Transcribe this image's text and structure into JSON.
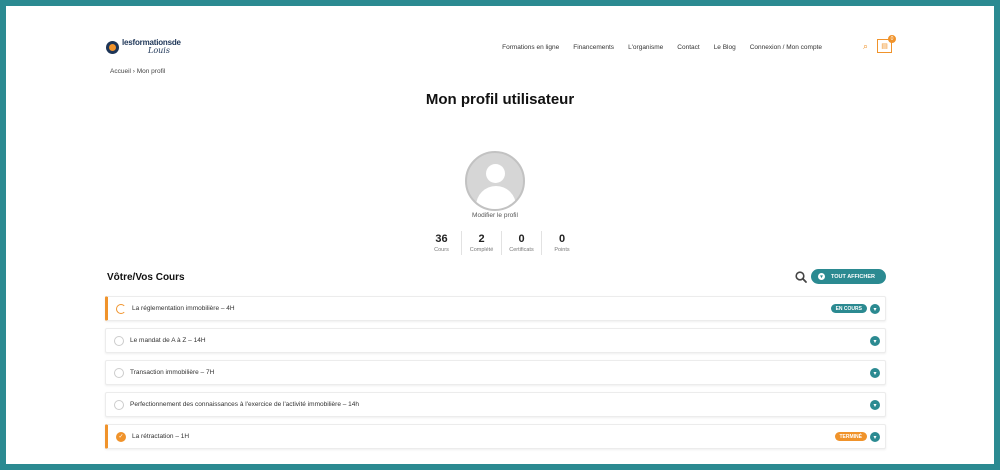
{
  "brand": {
    "name_top": "lesformationsde",
    "name_bottom": "Louis"
  },
  "nav": {
    "items": [
      {
        "label": "Formations en ligne"
      },
      {
        "label": "Financements"
      },
      {
        "label": "L'organisme"
      },
      {
        "label": "Contact"
      },
      {
        "label": "Le Blog"
      },
      {
        "label": "Connexion / Mon compte"
      }
    ],
    "cart_count": "0"
  },
  "breadcrumb": "Accueil › Mon profil",
  "page": {
    "title": "Mon profil utilisateur",
    "edit_profile": "Modifier le profil"
  },
  "stats": [
    {
      "value": "36",
      "label": "Cours"
    },
    {
      "value": "2",
      "label": "Complété"
    },
    {
      "value": "0",
      "label": "Certificats"
    },
    {
      "value": "0",
      "label": "Points"
    }
  ],
  "courses": {
    "title": "Vôtre/Vos Cours",
    "filter_label": "TOUT AFFICHER",
    "items": [
      {
        "name": "La réglementation immobilière – 4H",
        "status": "progress",
        "badge": "EN COURS",
        "badge_color": "#2b8a91"
      },
      {
        "name": "Le mandat de A à Z – 14H",
        "status": "none",
        "badge": "",
        "badge_color": ""
      },
      {
        "name": "Transaction immobilière – 7H",
        "status": "none",
        "badge": "",
        "badge_color": ""
      },
      {
        "name": "Perfectionnement des connaissances à l'exercice de l'activité immobilière – 14h",
        "status": "none",
        "badge": "",
        "badge_color": ""
      },
      {
        "name": "La rétractation – 1H",
        "status": "done",
        "badge": "TERMINÉ",
        "badge_color": "#f0932b"
      }
    ]
  },
  "colors": {
    "accent": "#2b8a91",
    "brand_orange": "#f0932b",
    "brand_navy": "#1d3557"
  }
}
